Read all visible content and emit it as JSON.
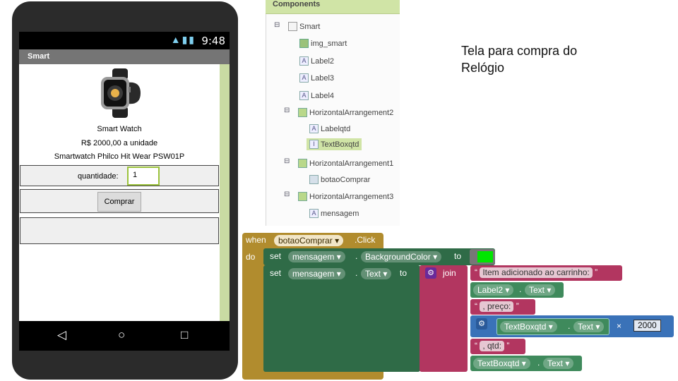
{
  "phone": {
    "status_time": "9:48",
    "status_icons": "wifi-signal-battery",
    "title": "Smart",
    "product_name": "Smart Watch",
    "price": "R$ 2000,00 a unidade",
    "description": "Smartwatch Philco Hit Wear PSW01P",
    "quantity_label": "quantidade:",
    "quantity_value": "1",
    "buy_label": "Comprar"
  },
  "components": {
    "header": "Components",
    "items": [
      "Smart",
      "img_smart",
      "Label2",
      "Label3",
      "Label4",
      "HorizontalArrangement2",
      "Labelqtd",
      "TextBoxqtd",
      "HorizontalArrangement1",
      "botaoComprar",
      "HorizontalArrangement3",
      "mensagem"
    ],
    "toggle_symbol": "⊟"
  },
  "note": {
    "line1": "Tela para compra do",
    "line2": "Relógio"
  },
  "blocks": {
    "when": "when",
    "event_component": "botaoComprar",
    "event_name": ".Click",
    "do": "do",
    "set": "set",
    "to": "to",
    "dot": ".",
    "row1_component": "mensagem",
    "row1_property": "BackgroundColor",
    "row2_component": "mensagem",
    "row2_property": "Text",
    "join": "join",
    "str1": "Item adicionado ao carrinho:",
    "label2": "Label2",
    "text_prop": "Text",
    "str2": ", preço:",
    "textbox": "TextBoxqtd",
    "times": "×",
    "number": "2000",
    "str3": ", qtd:",
    "textbox2": "TextBoxqtd",
    "quote_open": "“",
    "quote_close": "”",
    "dropdown_arrow": "▾",
    "color_value": "#00e600"
  }
}
